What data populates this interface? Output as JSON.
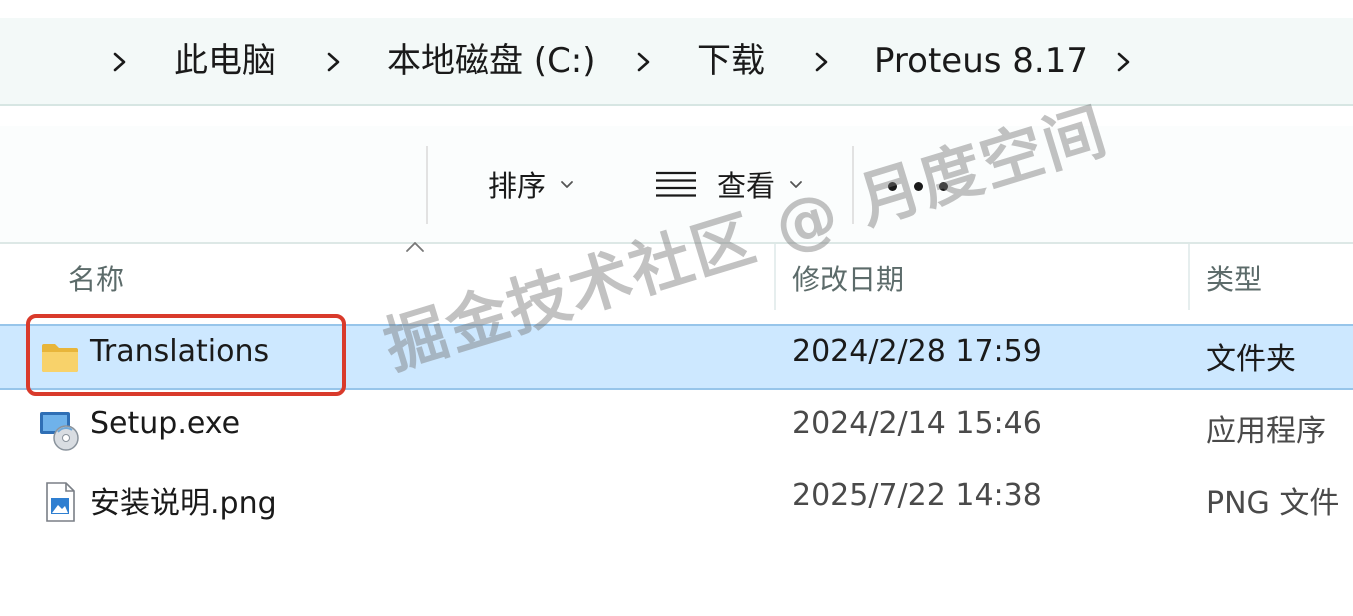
{
  "breadcrumb": {
    "items": [
      "此电脑",
      "本地磁盘 (C:)",
      "下载",
      "Proteus 8.17"
    ],
    "separator_icon": "chevron-right-icon"
  },
  "toolbar": {
    "sort_label": "排序",
    "view_label": "查看",
    "more_icon": "more-horizontal-icon",
    "view_icon": "list-view-icon"
  },
  "columns": {
    "name": "名称",
    "modified": "修改日期",
    "type": "类型"
  },
  "files": [
    {
      "name": "Translations",
      "modified": "2024/2/28 17:59",
      "type": "文件夹",
      "icon": "folder-icon",
      "selected": true
    },
    {
      "name": "Setup.exe",
      "modified": "2024/2/14 15:46",
      "type": "应用程序",
      "icon": "installer-icon",
      "selected": false
    },
    {
      "name": "安装说明.png",
      "modified": "2025/7/22 14:38",
      "type": "PNG 文件",
      "icon": "image-file-icon",
      "selected": false
    }
  ],
  "watermark": "掘金技术社区 @ 月度空间",
  "colors": {
    "selection": "#cde8ff",
    "highlight_box": "#d93a2b",
    "address_bg": "#f3f9f8"
  }
}
